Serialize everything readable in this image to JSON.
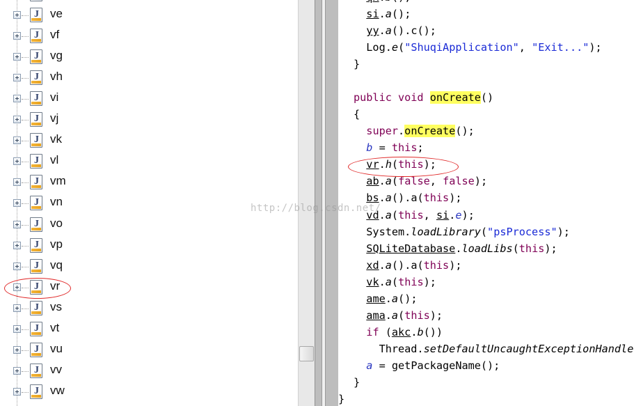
{
  "tree": {
    "items": [
      {
        "label": "ve"
      },
      {
        "label": "vf"
      },
      {
        "label": "vg"
      },
      {
        "label": "vh"
      },
      {
        "label": "vi"
      },
      {
        "label": "vj"
      },
      {
        "label": "vk"
      },
      {
        "label": "vl"
      },
      {
        "label": "vm"
      },
      {
        "label": "vn"
      },
      {
        "label": "vo"
      },
      {
        "label": "vp"
      },
      {
        "label": "vq"
      },
      {
        "label": "vr"
      },
      {
        "label": "vs"
      },
      {
        "label": "vt"
      },
      {
        "label": "vu"
      },
      {
        "label": "vv"
      },
      {
        "label": "vw"
      }
    ],
    "icon_letter": "J",
    "highlighted": "vr"
  },
  "code": {
    "lines": [
      [
        {
          "t": "  "
        },
        {
          "t": "qx",
          "c": "ul"
        },
        {
          "t": "."
        },
        {
          "t": "b",
          "c": "ital"
        },
        {
          "t": "();"
        }
      ],
      [
        {
          "t": "  "
        },
        {
          "t": "si",
          "c": "ul"
        },
        {
          "t": "."
        },
        {
          "t": "a",
          "c": "ital"
        },
        {
          "t": "();"
        }
      ],
      [
        {
          "t": "  "
        },
        {
          "t": "yy",
          "c": "ul"
        },
        {
          "t": "."
        },
        {
          "t": "a",
          "c": "ital"
        },
        {
          "t": "().c();"
        }
      ],
      [
        {
          "t": "  Log."
        },
        {
          "t": "e",
          "c": "ital"
        },
        {
          "t": "("
        },
        {
          "t": "\"ShuqiApplication\"",
          "c": "str"
        },
        {
          "t": ", "
        },
        {
          "t": "\"Exit...\"",
          "c": "str"
        },
        {
          "t": ");"
        }
      ],
      [
        {
          "t": "}"
        }
      ],
      [
        {
          "t": ""
        }
      ],
      [
        {
          "t": "public void ",
          "c": "kw"
        },
        {
          "t": "onCreate",
          "c": "hl"
        },
        {
          "t": "()"
        }
      ],
      [
        {
          "t": "{"
        }
      ],
      [
        {
          "t": "  "
        },
        {
          "t": "super",
          "c": "kw"
        },
        {
          "t": "."
        },
        {
          "t": "onCreate",
          "c": "hl"
        },
        {
          "t": "();"
        }
      ],
      [
        {
          "t": "  "
        },
        {
          "t": "b",
          "c": "fld"
        },
        {
          "t": " = "
        },
        {
          "t": "this",
          "c": "kw"
        },
        {
          "t": ";"
        }
      ],
      [
        {
          "t": "  "
        },
        {
          "t": "vr",
          "c": "ul"
        },
        {
          "t": "."
        },
        {
          "t": "h",
          "c": "ital"
        },
        {
          "t": "("
        },
        {
          "t": "this",
          "c": "kw"
        },
        {
          "t": ");"
        }
      ],
      [
        {
          "t": "  "
        },
        {
          "t": "ab",
          "c": "ul"
        },
        {
          "t": "."
        },
        {
          "t": "a",
          "c": "ital"
        },
        {
          "t": "("
        },
        {
          "t": "false",
          "c": "kw"
        },
        {
          "t": ", "
        },
        {
          "t": "false",
          "c": "kw"
        },
        {
          "t": ");"
        }
      ],
      [
        {
          "t": "  "
        },
        {
          "t": "bs",
          "c": "ul"
        },
        {
          "t": "."
        },
        {
          "t": "a",
          "c": "ital"
        },
        {
          "t": "().a("
        },
        {
          "t": "this",
          "c": "kw"
        },
        {
          "t": ");"
        }
      ],
      [
        {
          "t": "  "
        },
        {
          "t": "vd",
          "c": "ul"
        },
        {
          "t": "."
        },
        {
          "t": "a",
          "c": "ital"
        },
        {
          "t": "("
        },
        {
          "t": "this",
          "c": "kw"
        },
        {
          "t": ", "
        },
        {
          "t": "si",
          "c": "ul"
        },
        {
          "t": "."
        },
        {
          "t": "e",
          "c": "fld"
        },
        {
          "t": ");"
        }
      ],
      [
        {
          "t": "  System."
        },
        {
          "t": "loadLibrary",
          "c": "ital"
        },
        {
          "t": "("
        },
        {
          "t": "\"psProcess\"",
          "c": "str"
        },
        {
          "t": ");"
        }
      ],
      [
        {
          "t": "  "
        },
        {
          "t": "SQLiteDatabase",
          "c": "ul"
        },
        {
          "t": "."
        },
        {
          "t": "loadLibs",
          "c": "ital"
        },
        {
          "t": "("
        },
        {
          "t": "this",
          "c": "kw"
        },
        {
          "t": ");"
        }
      ],
      [
        {
          "t": "  "
        },
        {
          "t": "xd",
          "c": "ul"
        },
        {
          "t": "."
        },
        {
          "t": "a",
          "c": "ital"
        },
        {
          "t": "().a("
        },
        {
          "t": "this",
          "c": "kw"
        },
        {
          "t": ");"
        }
      ],
      [
        {
          "t": "  "
        },
        {
          "t": "vk",
          "c": "ul"
        },
        {
          "t": "."
        },
        {
          "t": "a",
          "c": "ital"
        },
        {
          "t": "("
        },
        {
          "t": "this",
          "c": "kw"
        },
        {
          "t": ");"
        }
      ],
      [
        {
          "t": "  "
        },
        {
          "t": "ame",
          "c": "ul"
        },
        {
          "t": "."
        },
        {
          "t": "a",
          "c": "ital"
        },
        {
          "t": "();"
        }
      ],
      [
        {
          "t": "  "
        },
        {
          "t": "ama",
          "c": "ul"
        },
        {
          "t": "."
        },
        {
          "t": "a",
          "c": "ital"
        },
        {
          "t": "("
        },
        {
          "t": "this",
          "c": "kw"
        },
        {
          "t": ");"
        }
      ],
      [
        {
          "t": "  "
        },
        {
          "t": "if",
          "c": "kw"
        },
        {
          "t": " ("
        },
        {
          "t": "akc",
          "c": "ul"
        },
        {
          "t": "."
        },
        {
          "t": "b",
          "c": "ital"
        },
        {
          "t": "())"
        }
      ],
      [
        {
          "t": "    Thread."
        },
        {
          "t": "setDefaultUncaughtExceptionHandler",
          "c": "ital"
        }
      ],
      [
        {
          "t": "  "
        },
        {
          "t": "a",
          "c": "fld"
        },
        {
          "t": " = getPackageName();"
        }
      ],
      [
        {
          "t": "}"
        }
      ],
      [
        {
          "t": "}"
        }
      ]
    ]
  },
  "watermark": "http://blog.csdn.net/",
  "colors": {
    "annotation": "#e02828",
    "keyword": "#7f0055",
    "string": "#1a2ad6",
    "highlight": "#ffff60"
  }
}
